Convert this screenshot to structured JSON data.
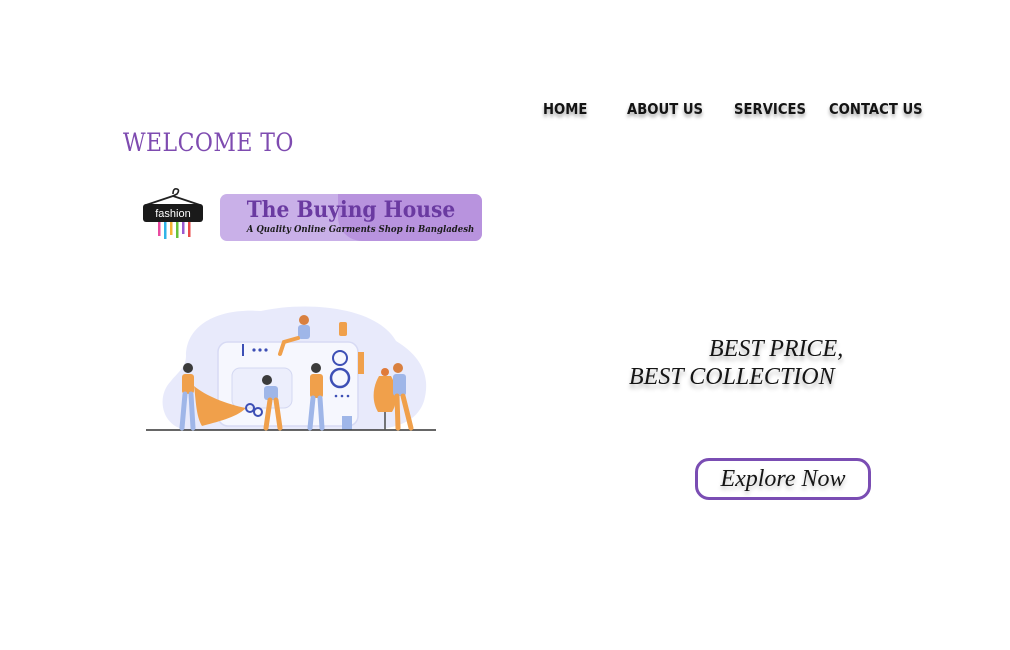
{
  "nav": {
    "items": [
      {
        "label": "HOME"
      },
      {
        "label": "ABOUT US"
      },
      {
        "label": "SERVICES"
      },
      {
        "label": "CONTACT US"
      }
    ]
  },
  "hero": {
    "welcome": "WELCOME TO",
    "logo_text": "fashion",
    "brand_name": "The Buying House",
    "brand_tagline": "A Quality Online Garments Shop in Bangladesh",
    "tagline_line1": "BEST PRICE,",
    "tagline_line2": "BEST COLLECTION",
    "cta_label": "Explore Now"
  },
  "colors": {
    "accent": "#7e4bb0",
    "brand_bg": "#c9b0e8",
    "illustration_orange": "#f0a04b",
    "illustration_blue": "#e6e8fb"
  }
}
